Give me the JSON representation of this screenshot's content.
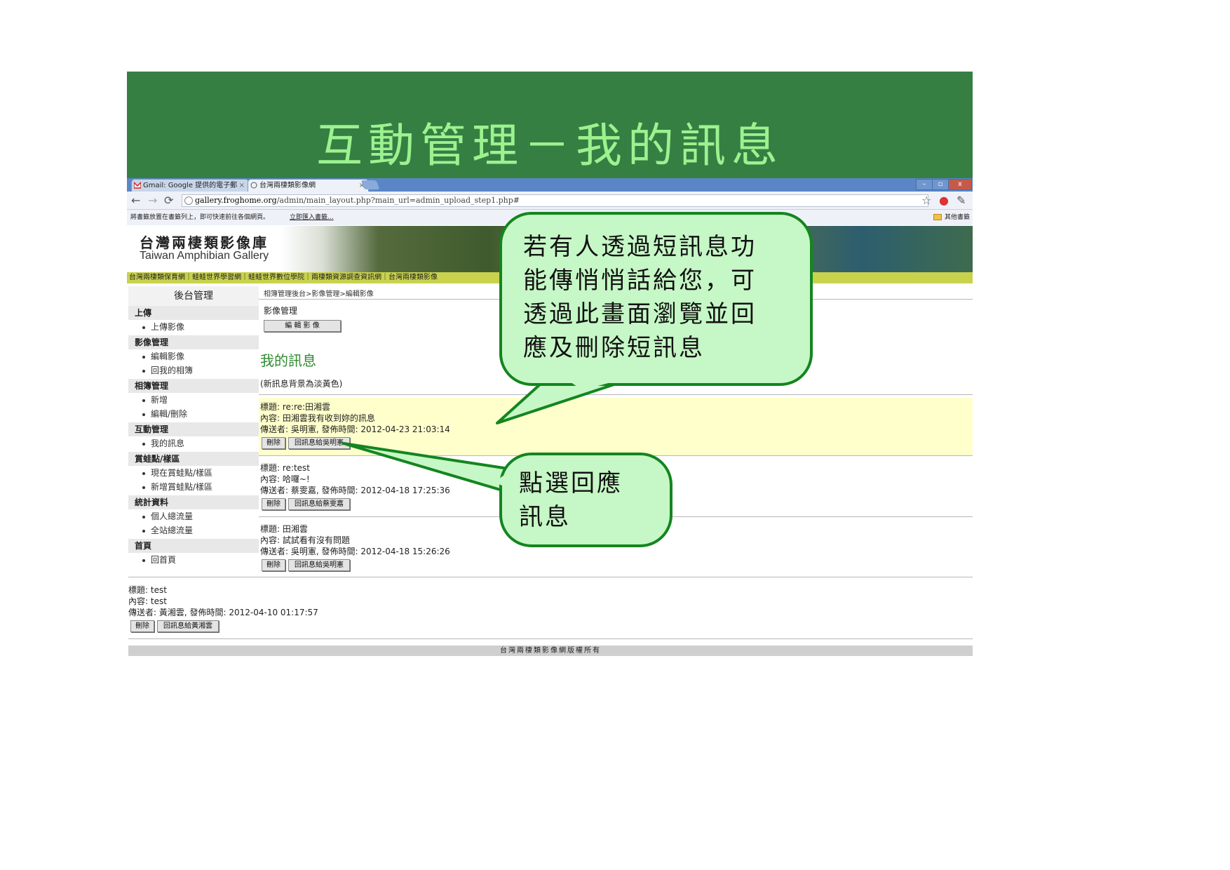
{
  "slide_title": "互動管理－我的訊息",
  "browser": {
    "tabs": [
      {
        "label": "Gmail: Google 提供的電子郵",
        "close": "×"
      },
      {
        "label": "台灣兩棲類影像網",
        "close": "×"
      }
    ],
    "window_buttons": [
      "–",
      "▫",
      "x"
    ],
    "address": {
      "host": "gallery.froghome.org",
      "path": "/admin/main_layout.php?main_url=admin_upload_step1.php#"
    },
    "bookmarks_hint": "將書籤放置在書籤列上，即可快速前往各個網頁。",
    "bookmarks_import": "立即匯入書籤...",
    "other_bookmarks": "其他書籤"
  },
  "site": {
    "title": "台灣兩棲類影像庫",
    "subtitle": "Taiwan Amphibian Gallery",
    "nav": "台灣兩棲類保育網｜蛙蛙世界學習網｜蛙蛙世界數位學院｜兩棲類資源調查資訊網｜台灣兩棲類影像"
  },
  "sidebar": {
    "title": "後台管理",
    "sections": [
      {
        "label": "上傳",
        "items": [
          "上傳影像"
        ]
      },
      {
        "label": "影像管理",
        "items": [
          "編輯影像",
          "回我的相簿"
        ]
      },
      {
        "label": "相簿管理",
        "items": [
          "新增",
          "編輯/刪除"
        ]
      },
      {
        "label": "互動管理",
        "items": [
          "我的訊息"
        ]
      },
      {
        "label": "賞蛙點/樣區",
        "items": [
          "現在賞蛙點/樣區",
          "新增賞蛙點/樣區"
        ]
      },
      {
        "label": "統計資料",
        "items": [
          "個人總流量",
          "全站總流量"
        ]
      },
      {
        "label": "首頁",
        "items": [
          "回首頁"
        ]
      }
    ]
  },
  "main": {
    "breadcrumb": "相簿管理後台>影像管理>編輯影像",
    "section_label": "影像管理",
    "edit_button": "編 輯 影 像",
    "heading": "我的訊息",
    "note": "(新訊息背景為淡黃色)",
    "messages": [
      {
        "title": "標題: re:re:田湘雲",
        "content": "內容: 田湘雲我有收到妳的訊息",
        "meta": "傳送者: 吳明憲, 發佈時間: 2012-04-23 21:03:14",
        "delete": "刪除",
        "reply": "回訊息給吳明憲",
        "new": true
      },
      {
        "title": "標題: re:test",
        "content": "內容: 哈囉~!",
        "meta": "傳送者: 蔡雯嘉, 發佈時間: 2012-04-18 17:25:36",
        "delete": "刪除",
        "reply": "回訊息給蔡雯嘉",
        "new": false
      },
      {
        "title": "標題: 田湘雲",
        "content": "內容: 試試看有沒有問題",
        "meta": "傳送者: 吳明憲, 發佈時間: 2012-04-18 15:26:26",
        "delete": "刪除",
        "reply": "回訊息給吳明憲",
        "new": false
      },
      {
        "title": "標題: test",
        "content": "內容: test",
        "meta": "傳送者: 黃湘雲, 發佈時間: 2012-04-10 01:17:57",
        "delete": "刪除",
        "reply": "回訊息給黃湘雲",
        "new": false
      }
    ],
    "footer": "台灣兩棲類影像網版權所有"
  },
  "callouts": {
    "top": [
      "若有人透過短訊息功",
      "能傳悄悄話給您，可",
      "透過此畫面瀏覽並回",
      "應及刪除短訊息"
    ],
    "bottom": [
      "點選回應",
      "訊息"
    ]
  },
  "colors": {
    "title_band": "#367f43",
    "title_text": "#9cf28f",
    "new_message_bg": "#ffffcc",
    "callout_fill": "#c6f7c6",
    "callout_border": "#14851f",
    "site_nav": "#c9d24d"
  }
}
